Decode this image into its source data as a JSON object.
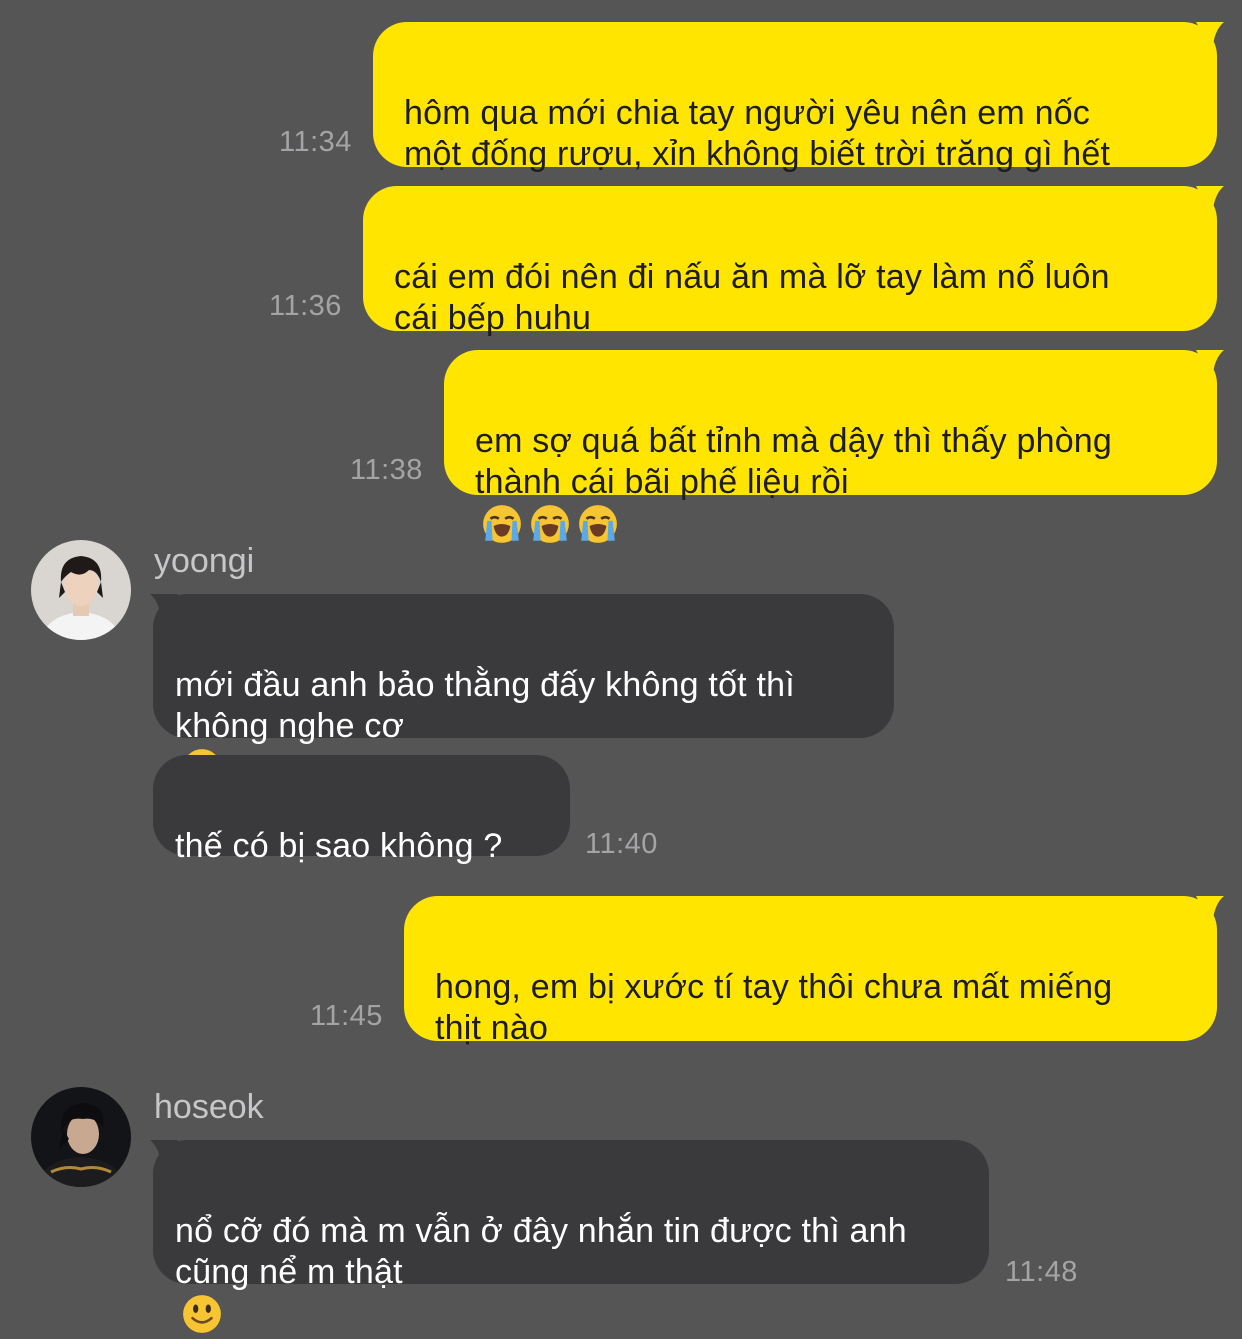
{
  "messages": [
    {
      "id": "m1",
      "text": "hôm qua mới chia tay người yêu nên em nốc\nmột đống rượu, xỉn không biết trời trăng gì hết",
      "time": "11:34"
    },
    {
      "id": "m2",
      "text": "cái em đói nên đi nấu ăn mà lỡ tay làm nổ luôn\ncái bếp huhu",
      "time": "11:36"
    },
    {
      "id": "m3",
      "text": "em sợ quá bất tỉnh mà dậy thì thấy phòng\nthành cái bãi phế liệu rồi",
      "emoji": [
        "loudly-crying-face",
        "loudly-crying-face",
        "loudly-crying-face"
      ],
      "time": "11:38"
    },
    {
      "id": "m4",
      "sender": "yoongi",
      "text": "mới đầu anh bảo thằng đấy không tốt thì\nkhông nghe cơ",
      "emoji": [
        "face-with-rolling-eyes"
      ]
    },
    {
      "id": "m5",
      "sender": "yoongi",
      "text": "thế có bị sao không ?",
      "time": "11:40"
    },
    {
      "id": "m6",
      "text": "hong, em bị xước tí tay thôi chưa mất miếng\nthịt nào",
      "time": "11:45"
    },
    {
      "id": "m7",
      "sender": "hoseok",
      "text": "nổ cỡ đó mà m vẫn ở đây nhắn tin được thì anh\ncũng nể m thật",
      "emoji": [
        "slightly-smiling-face"
      ],
      "time": "11:48"
    }
  ],
  "colors": {
    "background": "#555556",
    "outgoing": "#ffe500",
    "incoming": "#3a3a3c",
    "time": "#a4a4a6"
  }
}
